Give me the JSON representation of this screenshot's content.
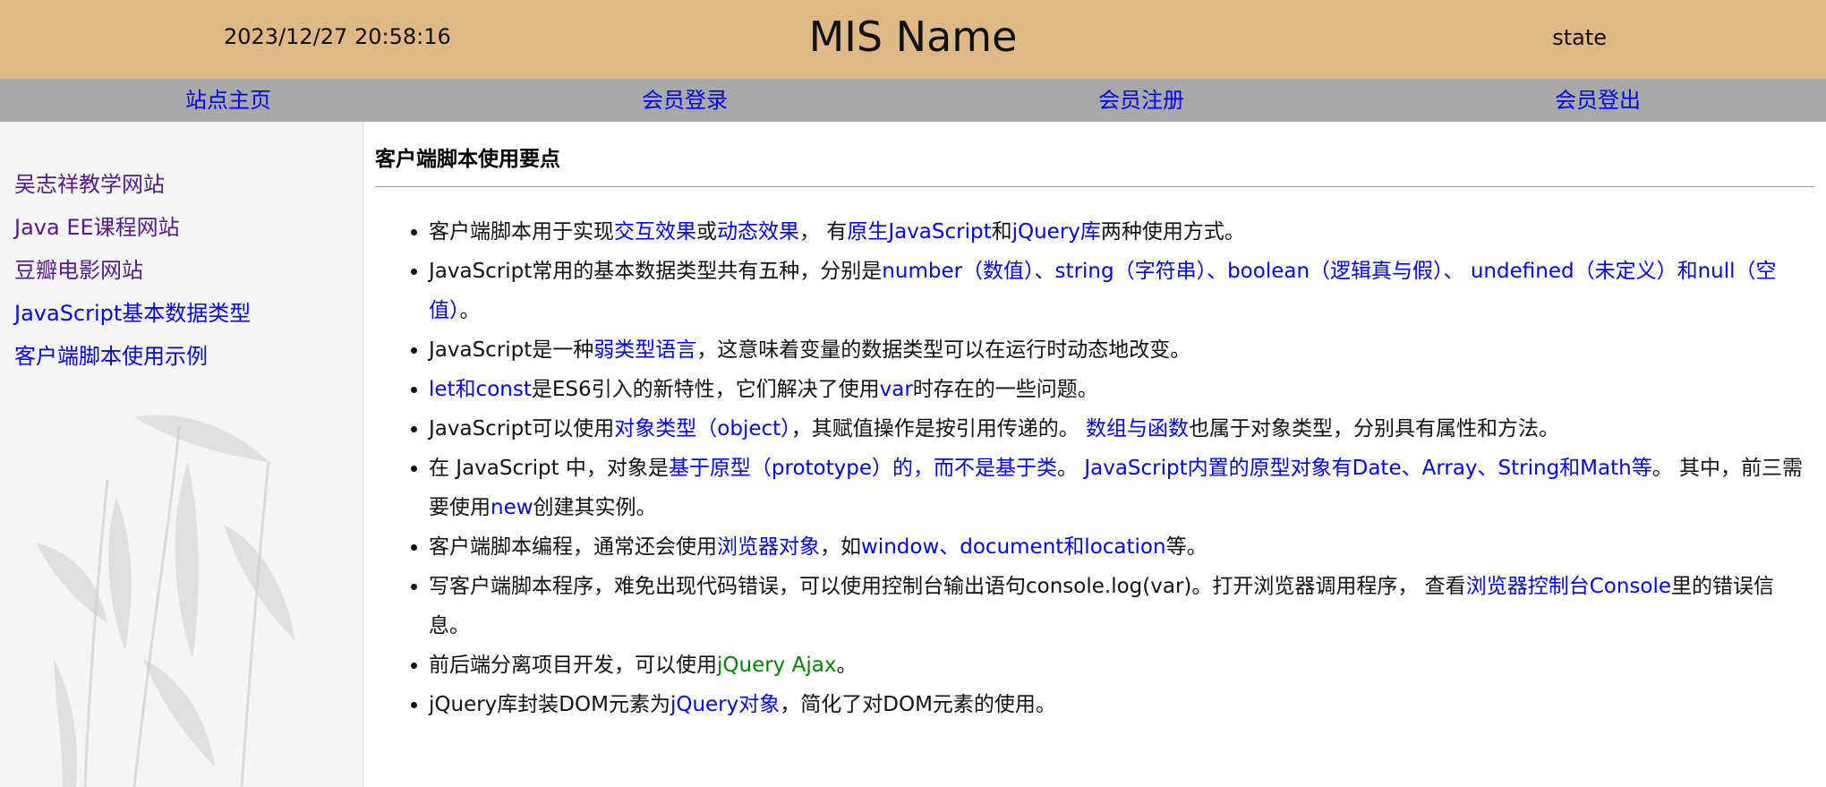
{
  "header": {
    "datetime": "2023/12/27 20:58:16",
    "title": "MIS Name",
    "state": "state"
  },
  "nav": {
    "home": "站点主页",
    "login": "会员登录",
    "register": "会员注册",
    "logout": "会员登出"
  },
  "sidebar": {
    "items": [
      "吴志祥教学网站",
      "Java EE课程网站",
      "豆瓣电影网站",
      "JavaScript基本数据类型",
      "客户端脚本使用示例"
    ]
  },
  "main": {
    "heading": "客户端脚本使用要点",
    "items": [
      [
        {
          "t": "客户端脚本用于实现"
        },
        {
          "t": "交互效果",
          "c": "hl"
        },
        {
          "t": "或"
        },
        {
          "t": "动态效果",
          "c": "hl"
        },
        {
          "t": "， 有"
        },
        {
          "t": "原生JavaScript",
          "c": "hl"
        },
        {
          "t": "和"
        },
        {
          "t": "jQuery库",
          "c": "hl"
        },
        {
          "t": "两种使用方式。"
        }
      ],
      [
        {
          "t": "JavaScript常用的基本数据类型共有五种，分别是"
        },
        {
          "t": "number（数值）、string（字符串）、boolean（逻辑真与假）、 undefined（未定义）和null（空值）",
          "c": "hl"
        },
        {
          "t": "。"
        }
      ],
      [
        {
          "t": "JavaScript是一种"
        },
        {
          "t": "弱类型语言",
          "c": "hl"
        },
        {
          "t": "，这意味着变量的数据类型可以在运行时动态地改变。"
        }
      ],
      [
        {
          "t": "let和const",
          "c": "hl"
        },
        {
          "t": "是ES6引入的新特性，它们解决了使用"
        },
        {
          "t": "var",
          "c": "hl"
        },
        {
          "t": "时存在的一些问题。"
        }
      ],
      [
        {
          "t": "JavaScript可以使用"
        },
        {
          "t": "对象类型（object）",
          "c": "hl"
        },
        {
          "t": "，其赋值操作是按引用传递的。 "
        },
        {
          "t": "数组与函数",
          "c": "hl"
        },
        {
          "t": "也属于对象类型，分别具有属性和方法。"
        }
      ],
      [
        {
          "t": "在 JavaScript 中，对象是"
        },
        {
          "t": "基于原型（prototype）的，而不是基于类",
          "c": "hl"
        },
        {
          "t": "。 "
        },
        {
          "t": "JavaScript内置的原型对象有Date、Array、String和Math等",
          "c": "hl"
        },
        {
          "t": "。 其中，前三需要使用"
        },
        {
          "t": "new",
          "c": "hl"
        },
        {
          "t": "创建其实例。"
        }
      ],
      [
        {
          "t": "客户端脚本编程，通常还会使用"
        },
        {
          "t": "浏览器对象",
          "c": "hl"
        },
        {
          "t": "，如"
        },
        {
          "t": "window、document和location",
          "c": "hl"
        },
        {
          "t": "等。"
        }
      ],
      [
        {
          "t": "写客户端脚本程序，难免出现代码错误，可以使用控制台输出语句console.log(var)。打开浏览器调用程序， 查看"
        },
        {
          "t": "浏览器控制台Console",
          "c": "hl"
        },
        {
          "t": "里的错误信息。"
        }
      ],
      [
        {
          "t": "前后端分离项目开发，可以使用"
        },
        {
          "t": "jQuery Ajax",
          "c": "hl-g"
        },
        {
          "t": "。"
        }
      ],
      [
        {
          "t": "jQuery库封装DOM元素为"
        },
        {
          "t": "jQuery对象",
          "c": "hl"
        },
        {
          "t": "，简化了对DOM元素的使用。"
        }
      ]
    ]
  },
  "colors": {
    "header_bg": "#deb887",
    "nav_bg": "#a9a9a9",
    "link": "#0000ee",
    "visited": "#551a8b",
    "green": "#008000"
  }
}
